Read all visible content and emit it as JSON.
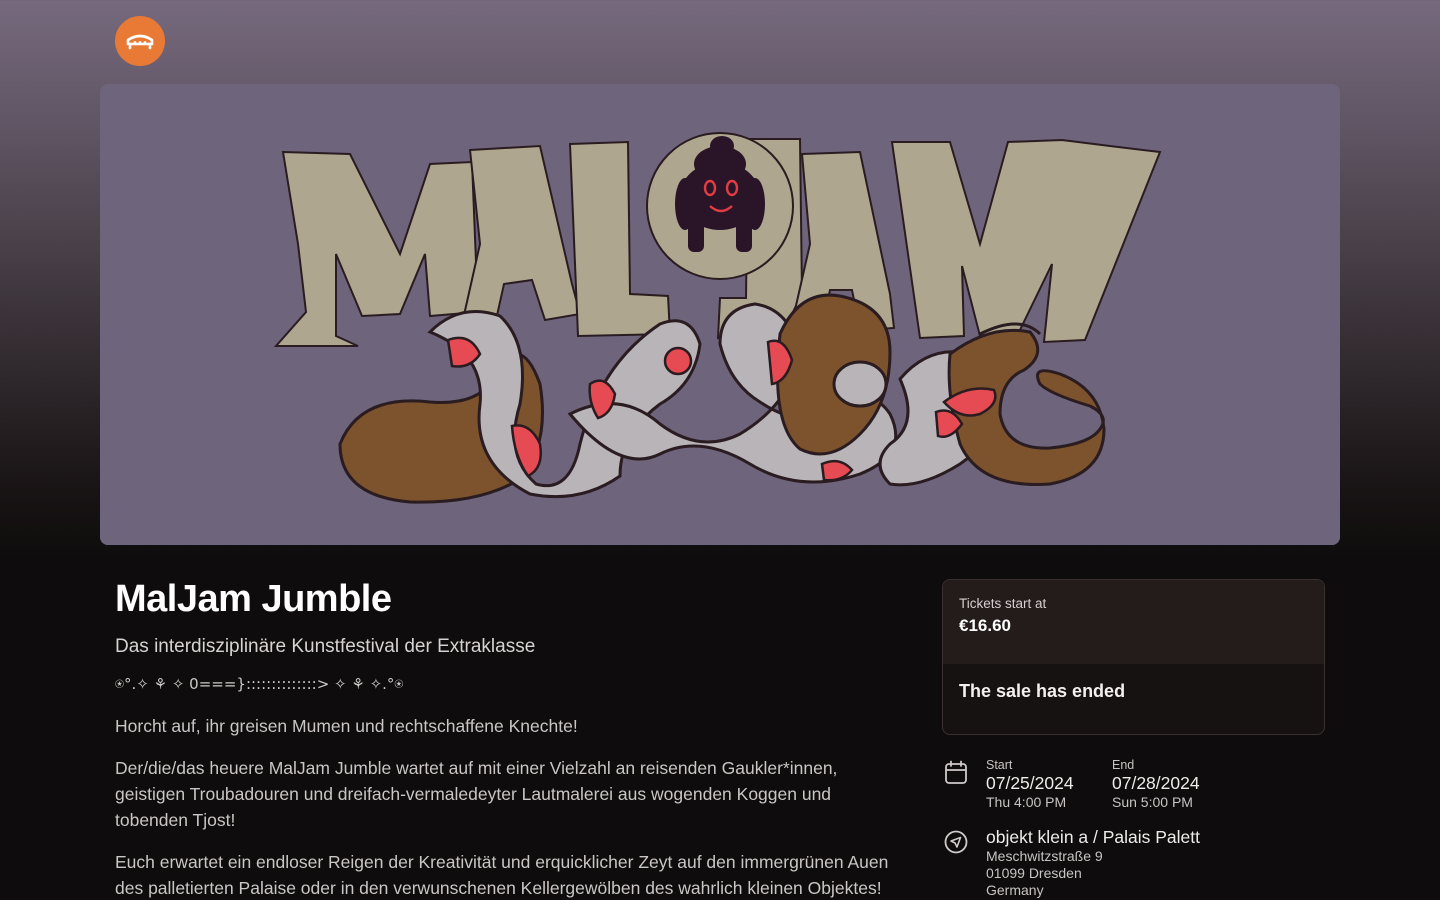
{
  "header": {
    "logo_icon": "ticket-shop-icon",
    "logo_color": "#e97a35"
  },
  "banner": {
    "alt": "MalJam Jumble"
  },
  "event": {
    "title": "MalJam Jumble",
    "subtitle": "Das interdisziplinäre Kunstfestival der Extraklasse",
    "decor_line": "⍟°.✧ ⚘ ✧ 0===}::::::::::::::> ✧ ⚘ ✧.°⍟",
    "paragraphs": [
      "Horcht auf, ihr greisen Mumen und rechtschaffene Knechte!",
      "Der/die/das heuere MalJam Jumble wartet auf mit einer Vielzahl an reisenden Gaukler*innen, geistigen Troubadouren und dreifach-vermaledeyter Lautmalerei aus wogenden Koggen und tobenden Tjost!",
      "Euch erwartet ein endloser Reigen der Kreativität und erquicklicher Zeyt auf den immergrünen Auen des palletierten Palaise oder in den verwunschenen Kellergewölben des wahrlich kleinen Objektes!"
    ]
  },
  "tickets": {
    "label": "Tickets start at",
    "price": "€16.60",
    "status": "The sale has ended"
  },
  "dates": {
    "icon": "calendar-icon",
    "start_label": "Start",
    "start_date": "07/25/2024",
    "start_time": "Thu 4:00 PM",
    "end_label": "End",
    "end_date": "07/28/2024",
    "end_time": "Sun 5:00 PM"
  },
  "venue": {
    "icon": "navigation-arrow-icon",
    "name": "objekt klein a / Palais Palett",
    "street": "Meschwitzstraße 9",
    "city": "01099 Dresden",
    "country": "Germany"
  }
}
